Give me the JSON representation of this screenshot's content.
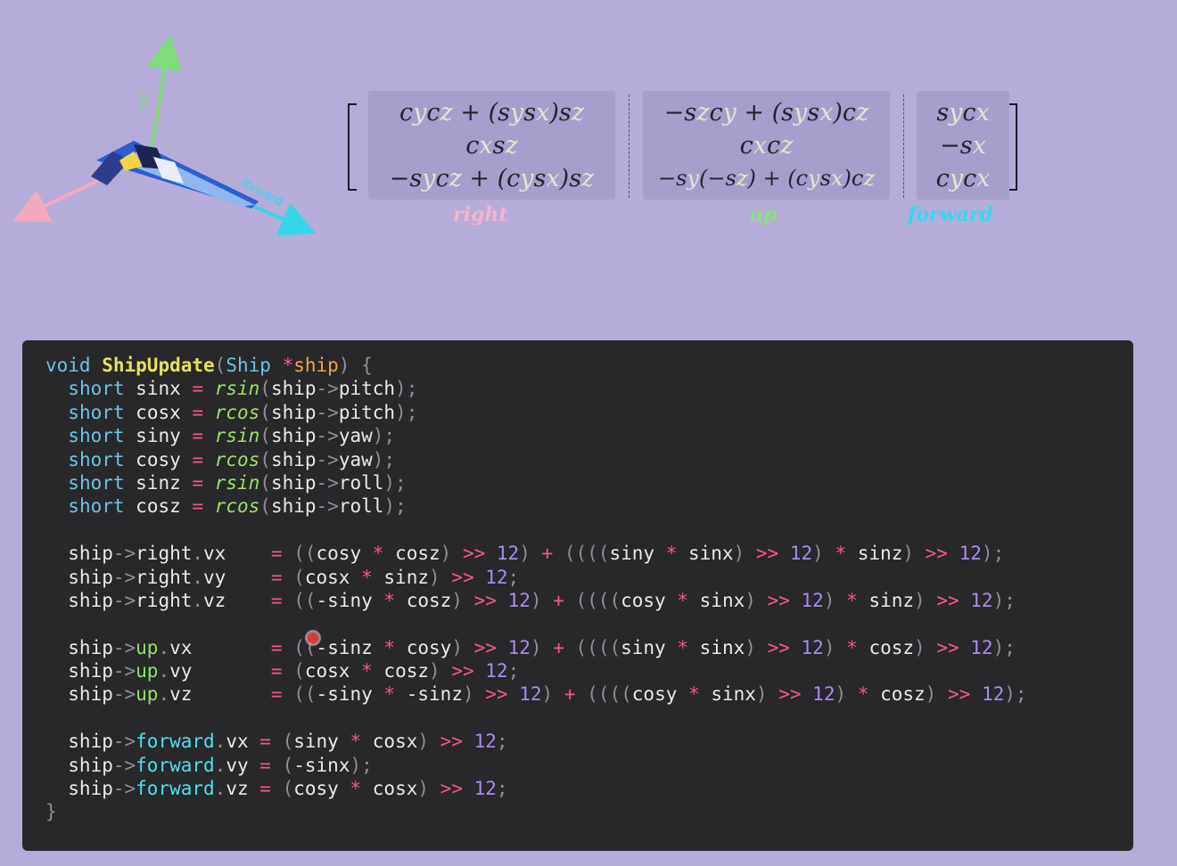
{
  "axes": {
    "up_label": "up",
    "right_label": "right",
    "forward_label": "forward",
    "colors": {
      "up": "#7fdc7a",
      "right": "#f2a8bd",
      "forward": "#35d6ea"
    }
  },
  "matrix": {
    "right": {
      "row1": [
        "c",
        "y",
        "c",
        "z",
        " + (",
        "s",
        "y",
        "s",
        "x",
        ")",
        "s",
        "z"
      ],
      "row2": [
        "c",
        "x",
        "s",
        "z"
      ],
      "row3": [
        "−",
        "s",
        "y",
        "c",
        "z",
        " + (",
        "c",
        "y",
        "s",
        "x",
        ")",
        "s",
        "z"
      ]
    },
    "up": {
      "row1": [
        "−",
        "s",
        "z",
        "c",
        "y",
        " + (",
        "s",
        "y",
        "s",
        "x",
        ")",
        "c",
        "z"
      ],
      "row2": [
        "c",
        "x",
        "c",
        "z"
      ],
      "row3": [
        "−",
        "s",
        "y",
        "(−",
        "s",
        "z",
        ") + (",
        "c",
        "y",
        "s",
        "x",
        ")",
        "c",
        "z"
      ]
    },
    "forward": {
      "row1": [
        "s",
        "y",
        "c",
        "x"
      ],
      "row2": [
        "−",
        "s",
        "x"
      ],
      "row3": [
        "c",
        "y",
        "c",
        "x"
      ]
    },
    "labels": {
      "right": "right",
      "up": "up",
      "forward": "forward"
    }
  },
  "code": {
    "line01": {
      "void": "void",
      "name": "ShipUpdate",
      "lp": "(",
      "type": "Ship",
      "star": "*",
      "param": "ship",
      "rp": ")",
      "brace": " {"
    },
    "decls": [
      {
        "type": "short",
        "var": "sinx",
        "fn": "rsin",
        "field": "pitch"
      },
      {
        "type": "short",
        "var": "cosx",
        "fn": "rcos",
        "field": "pitch"
      },
      {
        "type": "short",
        "var": "siny",
        "fn": "rsin",
        "field": "yaw"
      },
      {
        "type": "short",
        "var": "cosy",
        "fn": "rcos",
        "field": "yaw"
      },
      {
        "type": "short",
        "var": "sinz",
        "fn": "rsin",
        "field": "roll"
      },
      {
        "type": "short",
        "var": "cosz",
        "fn": "rcos",
        "field": "roll"
      }
    ],
    "assign": {
      "right_vx": "((cosy * cosz) >> 12) + ((((siny * sinx) >> 12) * sinz) >> 12);",
      "right_vy": "(cosx * sinz) >> 12;",
      "right_vz": "((-siny * cosz) >> 12) + ((((cosy * sinx) >> 12) * sinz) >> 12);",
      "up_vx": "((-sinz * cosy) >> 12) + ((((siny * sinx) >> 12) * cosz) >> 12);",
      "up_vy": "(cosx * cosz) >> 12;",
      "up_vz": "((-siny * -sinz) >> 12) + ((((cosy * sinx) >> 12) * cosz) >> 12);",
      "fw_vx": "(siny * cosx) >> 12;",
      "fw_vy": "(-sinx);",
      "fw_vz": "(cosy * cosx) >> 12;"
    },
    "closing": "}"
  }
}
